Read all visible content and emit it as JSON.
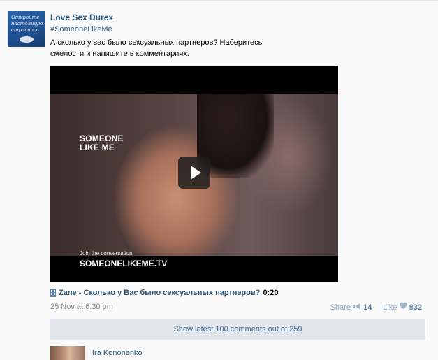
{
  "post": {
    "author": "Love Sex Durex",
    "avatar_lines": [
      "Откройте",
      "настоящую",
      "страсть с"
    ],
    "hashtag": "#SomeoneLikeMe",
    "text_line1": "А сколько у вас было сексуальных партнеров? Наберитесь",
    "text_line2": "смелости и напишите в комментариях.",
    "video": {
      "overlay_title_line1": "SOMEONE",
      "overlay_title_line2": "LIKE ME",
      "overlay_join": "Join the conversation",
      "overlay_url": "SOMEONELIKEME.TV",
      "play_icon": "play-icon",
      "title": "Zane - Сколько у Вас было сексуальных партнеров?",
      "duration": "0:20",
      "title_icon": "film-icon"
    },
    "date": "25 Nov at 6:30 pm",
    "share_label": "Share",
    "share_count": "14",
    "share_icon": "megaphone-icon",
    "like_label": "Like",
    "like_count": "832",
    "like_icon": "heart-icon"
  },
  "comments": {
    "show_more_label": "Show latest 100 comments out of 259",
    "first_comment": {
      "author": "Ira Kononenko"
    }
  },
  "colors": {
    "link": "#2b587a",
    "showmore_bg": "#e1e7ed",
    "muted": "#8a8a8a"
  }
}
